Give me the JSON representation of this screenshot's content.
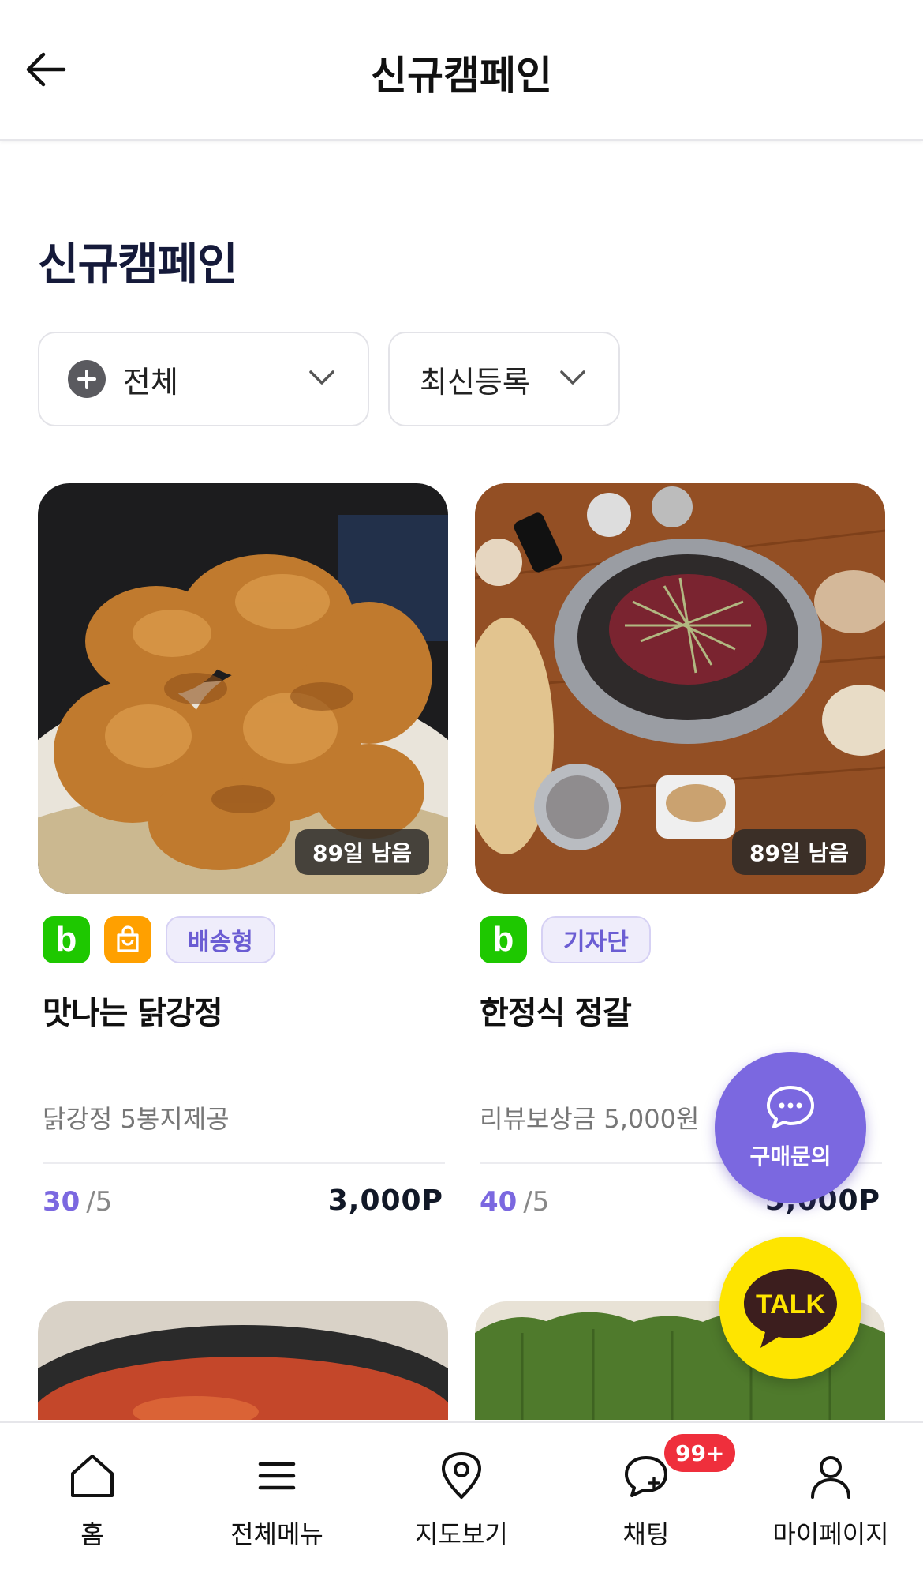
{
  "header": {
    "title": "신규캠페인",
    "back_icon": "arrow-left-icon"
  },
  "section": {
    "title": "신규캠페인"
  },
  "filters": {
    "category": {
      "label": "전체",
      "icon": "plus-circle-icon"
    },
    "sort": {
      "label": "최신등록"
    }
  },
  "cards": [
    {
      "days_left": "89일 남음",
      "platform_badge": "b",
      "type_tag": "배송형",
      "title": "맛나는 닭강정",
      "description": "닭강정 5봉지제공",
      "count_current": "30",
      "count_total": "/5",
      "price": "3,000P"
    },
    {
      "days_left": "89일 남음",
      "platform_badge": "b",
      "type_tag": "기자단",
      "title": "한정식 정갈",
      "description": "리뷰보상금 5,000원",
      "count_current": "40",
      "count_total": "/5",
      "price": "5,000P"
    }
  ],
  "fab": {
    "inquiry_label": "구매문의",
    "talk_label": "TALK"
  },
  "bottom_nav": {
    "items": [
      {
        "label": "홈",
        "icon": "home-icon"
      },
      {
        "label": "전체메뉴",
        "icon": "menu-icon"
      },
      {
        "label": "지도보기",
        "icon": "map-pin-icon"
      },
      {
        "label": "채팅",
        "icon": "chat-icon",
        "badge": "99+"
      },
      {
        "label": "마이페이지",
        "icon": "user-icon"
      }
    ]
  },
  "colors": {
    "accent": "#7b68e0",
    "naver_green": "#1ec800",
    "shop_orange": "#ffa000",
    "kakao_yellow": "#fee500",
    "badge_red": "#ef2f3c"
  }
}
